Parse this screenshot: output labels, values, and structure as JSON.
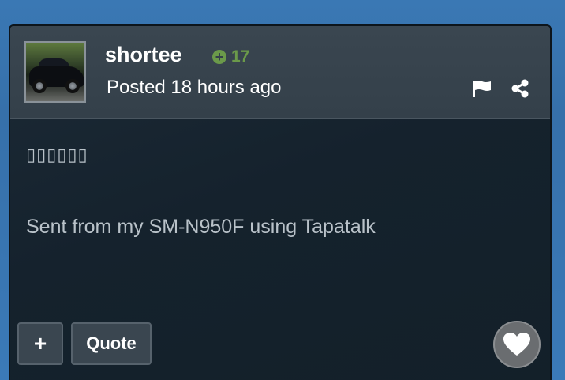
{
  "post": {
    "username": "shortee",
    "reputation": "17",
    "posted": "Posted 18 hours ago",
    "content_line_1": "▯▯▯▯▯▯",
    "content_line_2": "Sent from my SM-N950F using Tapatalk"
  },
  "actions": {
    "plus_label": "+",
    "quote_label": "Quote"
  },
  "icons": {
    "reputation": "plus-circle-icon",
    "report": "flag-icon",
    "share": "share-icon",
    "like": "heart-icon"
  },
  "colors": {
    "page_background": "#3a78b4",
    "card_background": "#15222d",
    "header_background": "#36424c",
    "reputation_green": "#6b9a4a",
    "text_muted": "#b9c2c9",
    "like_button": "#6a6d70"
  }
}
